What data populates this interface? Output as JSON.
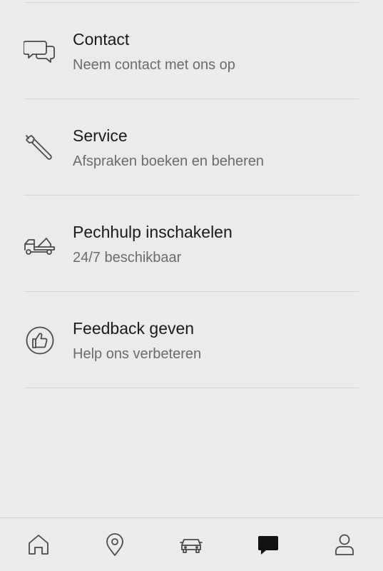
{
  "menu": {
    "items": [
      {
        "title": "Contact",
        "subtitle": "Neem contact met ons op",
        "icon": "chat-bubbles-icon"
      },
      {
        "title": "Service",
        "subtitle": "Afspraken boeken en beheren",
        "icon": "wrench-icon"
      },
      {
        "title": "Pechhulp inschakelen",
        "subtitle": "24/7 beschikbaar",
        "icon": "tow-truck-icon"
      },
      {
        "title": "Feedback geven",
        "subtitle": "Help ons verbeteren",
        "icon": "thumbs-up-icon"
      }
    ]
  },
  "tabbar": {
    "tabs": [
      {
        "name": "home",
        "icon": "home-icon",
        "active": false
      },
      {
        "name": "map",
        "icon": "location-pin-icon",
        "active": false
      },
      {
        "name": "car",
        "icon": "car-icon",
        "active": false
      },
      {
        "name": "support",
        "icon": "chat-bubble-icon",
        "active": true
      },
      {
        "name": "profile",
        "icon": "person-icon",
        "active": false
      }
    ]
  },
  "colors": {
    "background": "#ebebeb",
    "divider": "#d4d4d4",
    "title": "#1a1a1a",
    "subtitle": "#6b6b6b",
    "icon": "#4a4a4a",
    "active_tab": "#111111"
  }
}
